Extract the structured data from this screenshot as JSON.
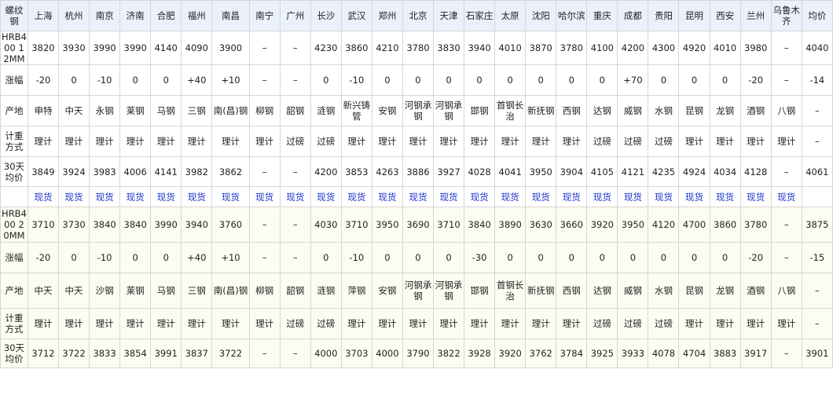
{
  "header": {
    "corner": "螺纹钢",
    "cities": [
      "上海",
      "杭州",
      "南京",
      "济南",
      "合肥",
      "福州",
      "南昌",
      "南宁",
      "广州",
      "长沙",
      "武汉",
      "郑州",
      "北京",
      "天津",
      "石家庄",
      "太原",
      "沈阳",
      "哈尔滨",
      "重庆",
      "成都",
      "贵阳",
      "昆明",
      "西安",
      "兰州",
      "乌鲁木齐"
    ],
    "avg": "均价"
  },
  "groups": [
    {
      "spec": "HRB400 12MM",
      "price": {
        "values": [
          "3820",
          "3930",
          "3990",
          "3990",
          "4140",
          "4090",
          "3900",
          "–",
          "–",
          "4230",
          "3860",
          "4210",
          "3780",
          "3830",
          "3940",
          "4010",
          "3870",
          "3780",
          "4100",
          "4200",
          "4300",
          "4920",
          "4010",
          "3980",
          "–"
        ],
        "avg": "4040"
      },
      "change": {
        "label": "涨幅",
        "values": [
          "-20",
          "0",
          "-10",
          "0",
          "0",
          "+40",
          "+10",
          "–",
          "–",
          "0",
          "-10",
          "0",
          "0",
          "0",
          "0",
          "0",
          "0",
          "0",
          "0",
          "+70",
          "0",
          "0",
          "0",
          "-20",
          "–"
        ],
        "avg": "-14"
      },
      "origin": {
        "label": "产地",
        "values": [
          "申特",
          "中天",
          "永钢",
          "莱钢",
          "马钢",
          "三钢",
          "南(昌)钢",
          "柳钢",
          "韶钢",
          "涟钢",
          "新兴铸管",
          "安钢",
          "河钢承钢",
          "河钢承钢",
          "邯钢",
          "首钢长治",
          "新抚钢",
          "西钢",
          "达钢",
          "威钢",
          "水钢",
          "昆钢",
          "龙钢",
          "酒钢",
          "八钢"
        ],
        "avg": "–"
      },
      "method": {
        "label": "计重方式",
        "values": [
          "理计",
          "理计",
          "理计",
          "理计",
          "理计",
          "理计",
          "理计",
          "理计",
          "过磅",
          "过磅",
          "理计",
          "理计",
          "理计",
          "理计",
          "理计",
          "理计",
          "理计",
          "理计",
          "过磅",
          "过磅",
          "过磅",
          "理计",
          "理计",
          "理计",
          "理计"
        ],
        "avg": "–"
      },
      "avg30": {
        "label": "30天均价",
        "values": [
          "3849",
          "3924",
          "3983",
          "4006",
          "4141",
          "3982",
          "3862",
          "–",
          "–",
          "4200",
          "3853",
          "4263",
          "3886",
          "3927",
          "4028",
          "4041",
          "3950",
          "3904",
          "4105",
          "4121",
          "4235",
          "4924",
          "4034",
          "4128",
          "–"
        ],
        "avg": "4061"
      },
      "spot": {
        "label": "",
        "values": [
          "现货",
          "现货",
          "现货",
          "现货",
          "现货",
          "现货",
          "现货",
          "现货",
          "现货",
          "现货",
          "现货",
          "现货",
          "现货",
          "现货",
          "现货",
          "现货",
          "现货",
          "现货",
          "现货",
          "现货",
          "现货",
          "现货",
          "现货",
          "现货",
          "现货"
        ],
        "avg": ""
      }
    },
    {
      "spec": "HRB400 20MM",
      "price": {
        "values": [
          "3710",
          "3730",
          "3840",
          "3840",
          "3990",
          "3940",
          "3760",
          "–",
          "–",
          "4030",
          "3710",
          "3950",
          "3690",
          "3710",
          "3840",
          "3890",
          "3630",
          "3660",
          "3920",
          "3950",
          "4120",
          "4700",
          "3860",
          "3780",
          "–"
        ],
        "avg": "3875"
      },
      "change": {
        "label": "涨幅",
        "values": [
          "-20",
          "0",
          "-10",
          "0",
          "0",
          "+40",
          "+10",
          "–",
          "–",
          "0",
          "-10",
          "0",
          "0",
          "0",
          "-30",
          "0",
          "0",
          "0",
          "0",
          "0",
          "0",
          "0",
          "0",
          "-20",
          "–"
        ],
        "avg": "-15"
      },
      "origin": {
        "label": "产地",
        "values": [
          "中天",
          "中天",
          "沙钢",
          "莱钢",
          "马钢",
          "三钢",
          "南(昌)钢",
          "柳钢",
          "韶钢",
          "涟钢",
          "萍钢",
          "安钢",
          "河钢承钢",
          "河钢承钢",
          "邯钢",
          "首钢长治",
          "新抚钢",
          "西钢",
          "达钢",
          "威钢",
          "水钢",
          "昆钢",
          "龙钢",
          "酒钢",
          "八钢"
        ],
        "avg": "–"
      },
      "method": {
        "label": "计重方式",
        "values": [
          "理计",
          "理计",
          "理计",
          "理计",
          "理计",
          "理计",
          "理计",
          "理计",
          "过磅",
          "过磅",
          "理计",
          "理计",
          "理计",
          "理计",
          "理计",
          "理计",
          "理计",
          "理计",
          "过磅",
          "过磅",
          "过磅",
          "理计",
          "理计",
          "理计",
          "理计"
        ],
        "avg": "–"
      },
      "avg30": {
        "label": "30天均价",
        "values": [
          "3712",
          "3722",
          "3833",
          "3854",
          "3991",
          "3837",
          "3722",
          "–",
          "–",
          "4000",
          "3703",
          "4000",
          "3790",
          "3822",
          "3928",
          "3920",
          "3762",
          "3784",
          "3925",
          "3933",
          "4078",
          "4704",
          "3883",
          "3917",
          "–"
        ],
        "avg": "3901"
      }
    }
  ]
}
